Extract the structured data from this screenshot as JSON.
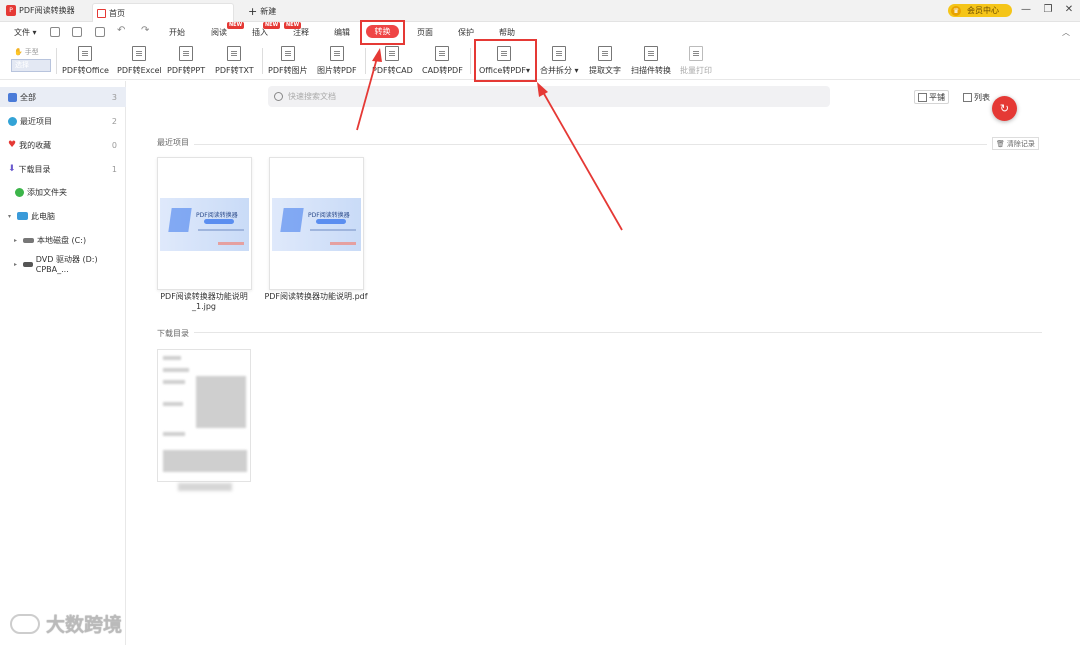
{
  "titlebar": {
    "app_title": "PDF阅读转换器",
    "logo_text": "P",
    "home_tab": "首页",
    "new_tab": "新建",
    "vip_label": "会员中心"
  },
  "menu": {
    "file": "文件",
    "tabs": [
      "开始",
      "阅读",
      "插入",
      "注释",
      "编辑",
      "转换",
      "页面",
      "保护",
      "帮助"
    ],
    "new_badge": "NEW"
  },
  "toolbar": {
    "hand": "手型",
    "select": "选择",
    "tools": [
      "PDF转Office",
      "PDF转Excel",
      "PDF转PPT",
      "PDF转TXT",
      "PDF转图片",
      "图片转PDF",
      "PDF转CAD",
      "CAD转PDF",
      "Office转PDF",
      "合并拆分",
      "提取文字",
      "扫描件转换",
      "批量打印"
    ]
  },
  "sidebar": {
    "items": [
      {
        "label": "全部",
        "count": "3"
      },
      {
        "label": "最近项目",
        "count": "2"
      },
      {
        "label": "我的收藏",
        "count": "0"
      },
      {
        "label": "下载目录",
        "count": "1"
      }
    ],
    "add_folder": "添加文件夹",
    "this_pc": "此电脑",
    "local_disk": "本地磁盘 (C:)",
    "dvd": "DVD 驱动器 (D:) CPBA_..."
  },
  "main": {
    "search_placeholder": "快速搜索文档",
    "view_tile": "平铺",
    "view_list": "列表",
    "recent_label": "最近项目",
    "clear_label": "清除记录",
    "download_label": "下载目录",
    "files": [
      {
        "name": "PDF阅读转换器功能说明_1.jpg",
        "thumb_title": "PDF阅读转换器"
      },
      {
        "name": "PDF阅读转换器功能说明.pdf",
        "thumb_title": "PDF阅读转换器"
      }
    ]
  },
  "watermark": "大数跨境",
  "colors": {
    "accent": "#e53935",
    "vip": "#f5c518"
  }
}
